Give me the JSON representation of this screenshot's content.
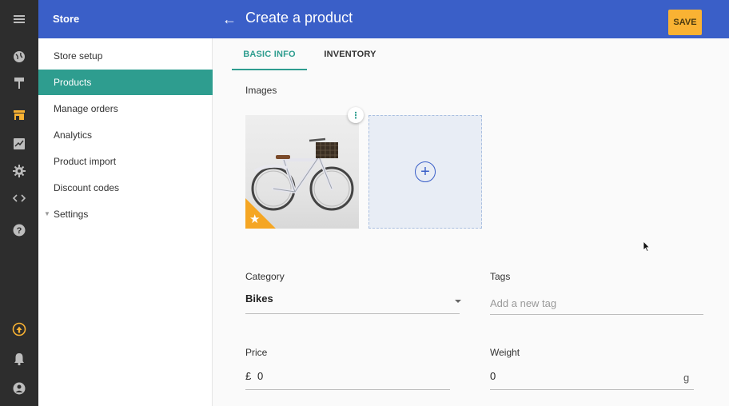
{
  "rail": {
    "icons": [
      "menu-icon",
      "globe-icon",
      "paint-roller-icon",
      "store-icon",
      "chart-icon",
      "settings-icon",
      "code-icon",
      "help-icon",
      "upgrade-icon",
      "notifications-icon",
      "account-icon"
    ]
  },
  "header": {
    "store_title": "Store",
    "back_glyph": "←",
    "page_title": "Create a product",
    "save_label": "SAVE"
  },
  "nav": {
    "items": [
      {
        "label": "Store setup"
      },
      {
        "label": "Products"
      },
      {
        "label": "Manage orders"
      },
      {
        "label": "Analytics"
      },
      {
        "label": "Product import"
      },
      {
        "label": "Discount codes"
      },
      {
        "label": "Settings"
      }
    ]
  },
  "tabs": [
    {
      "label": "BASIC INFO"
    },
    {
      "label": "INVENTORY"
    }
  ],
  "form": {
    "images_label": "Images",
    "star_glyph": "★",
    "menu_glyph": "⋮",
    "add_glyph": "+",
    "category_label": "Category",
    "category_value": "Bikes",
    "tags_label": "Tags",
    "tags_placeholder": "Add a new tag",
    "price_label": "Price",
    "currency": "£",
    "price_value": "0",
    "weight_label": "Weight",
    "weight_value": "0",
    "weight_unit": "g"
  },
  "colors": {
    "topbar": "#3a5fc8",
    "accent_teal": "#2e9d8f",
    "save_yellow": "#f9b233",
    "rail_dark": "#2d2d2d"
  }
}
